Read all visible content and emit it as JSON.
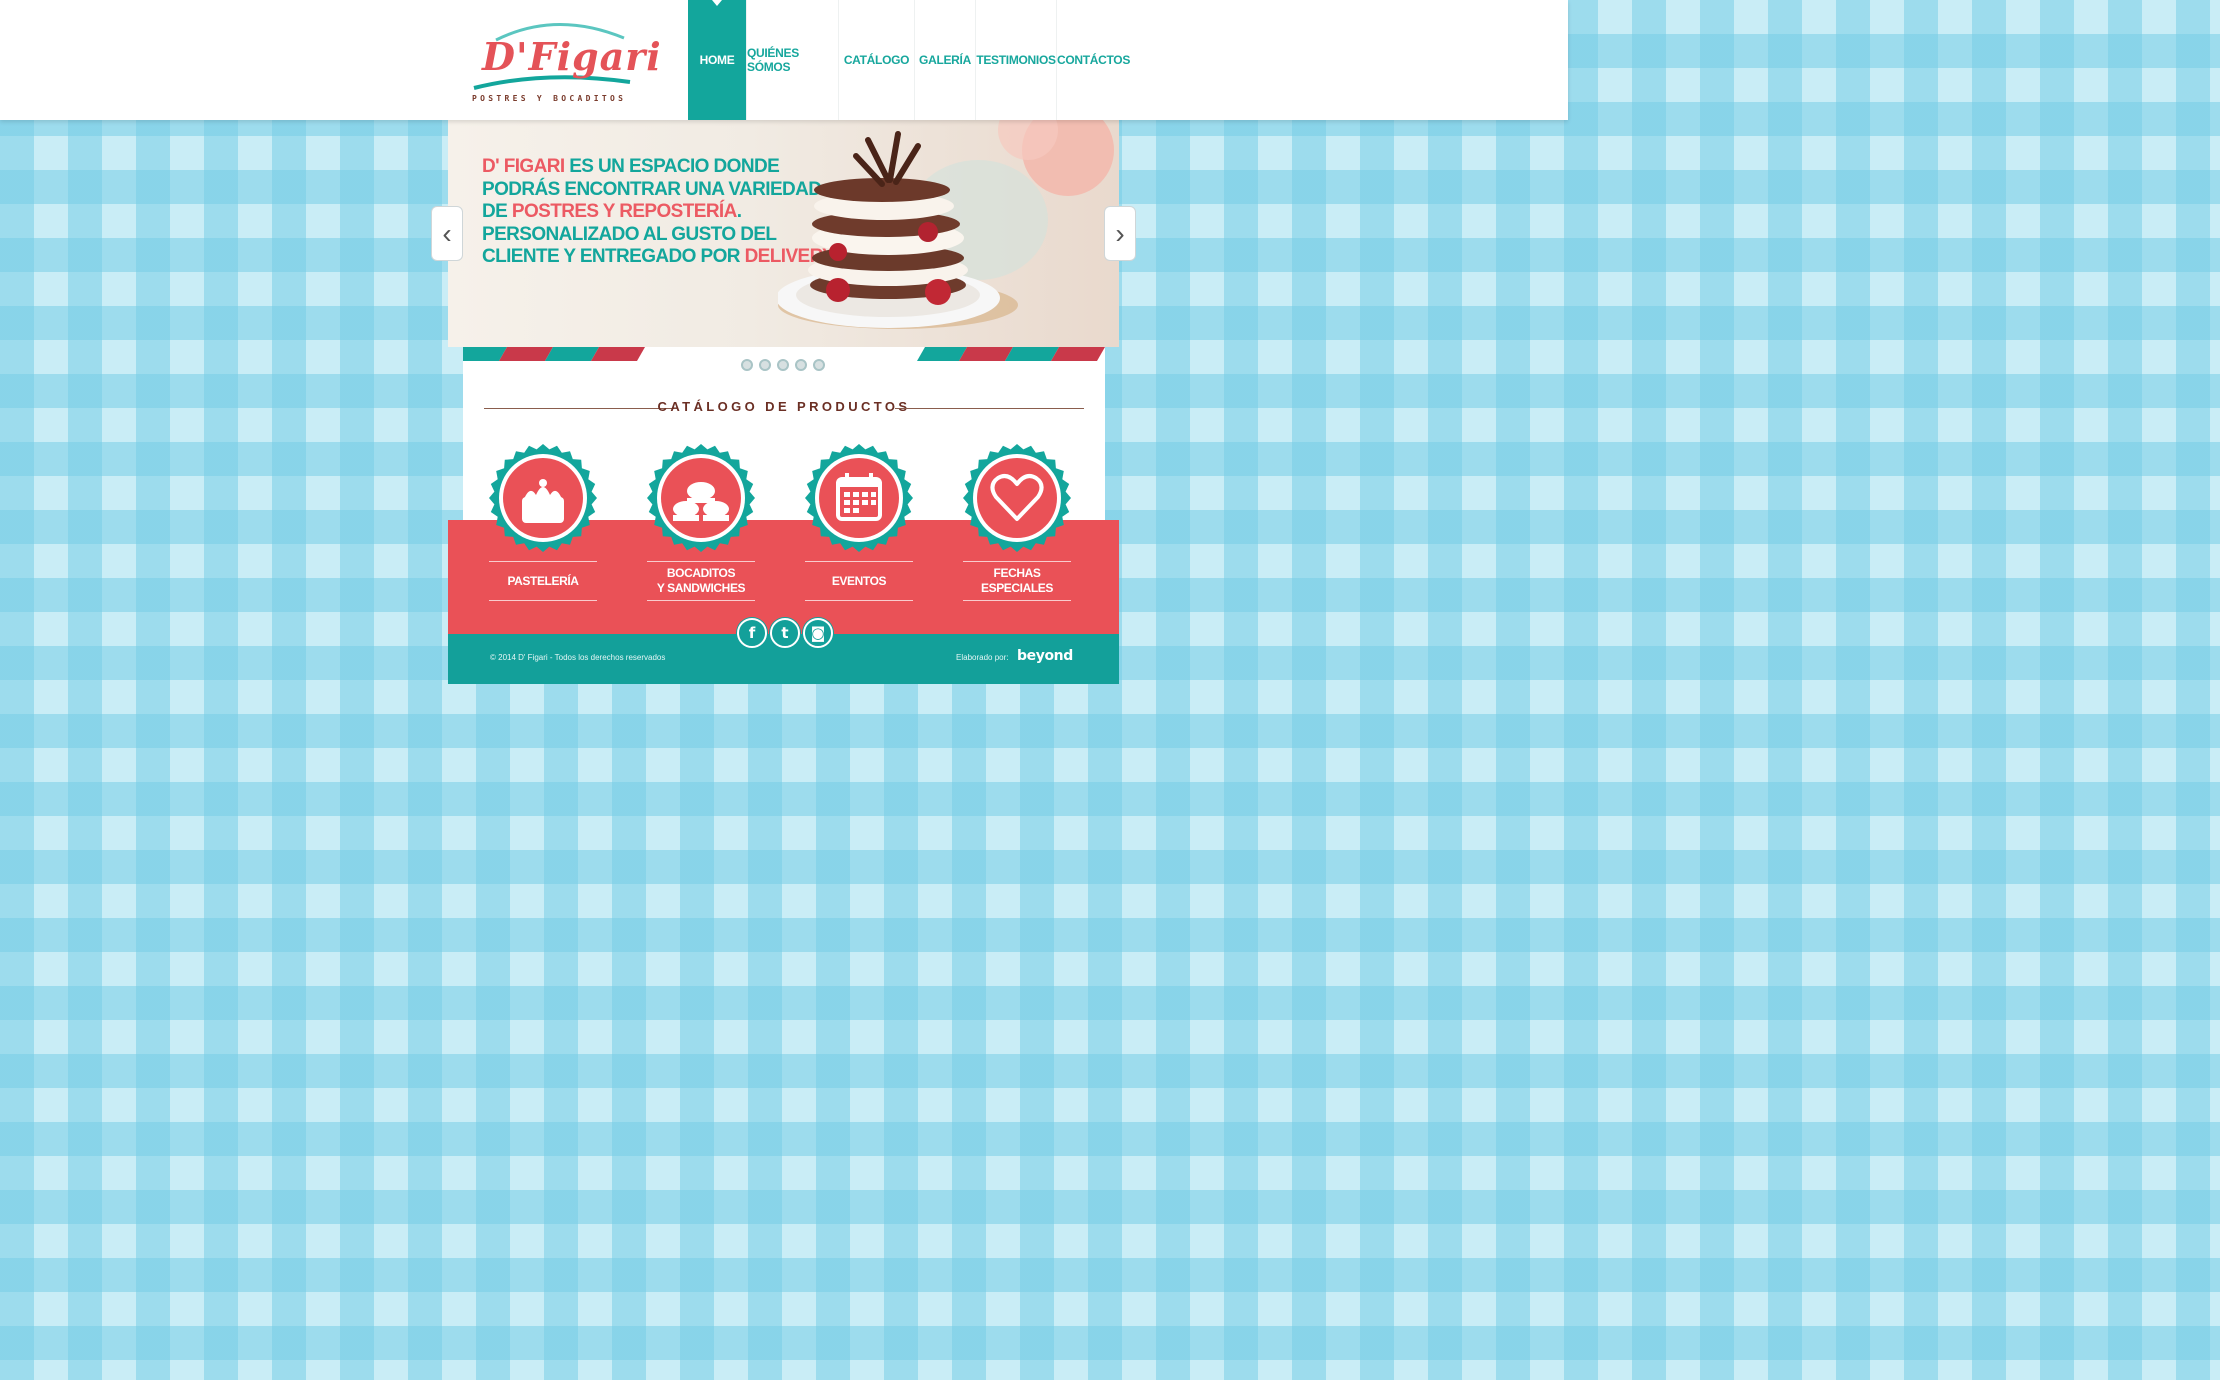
{
  "brand": {
    "name": "D'Figari",
    "tagline": "POSTRES Y BOCADITOS"
  },
  "nav": {
    "items": [
      {
        "label": "HOME"
      },
      {
        "label": "QUIÉNES SÓMOS"
      },
      {
        "label": "CATÁLOGO"
      },
      {
        "label": "GALERÍA"
      },
      {
        "label": "TESTIMONIOS"
      },
      {
        "label": "CONTÁCTOS"
      }
    ],
    "active_index": 0
  },
  "slider": {
    "text_parts": [
      {
        "text": "D' Figari",
        "highlight": true
      },
      {
        "text": " es un espacio donde podrás encontrar una variedad de ",
        "highlight": false
      },
      {
        "text": "postres y repostería",
        "highlight": true
      },
      {
        "text": ". Personalizado al gusto del cliente y entregado por ",
        "highlight": false
      },
      {
        "text": "delivery",
        "highlight": true
      },
      {
        "text": ".",
        "highlight": false
      }
    ],
    "prev_icon": "chevron-left-icon",
    "next_icon": "chevron-right-icon",
    "slide_count": 5
  },
  "catalog": {
    "title": "CATÁLOGO DE PRODUCTOS",
    "products": [
      {
        "label": "PASTELERÍA",
        "icon": "cake-icon"
      },
      {
        "label": "BOCADITOS\nY SANDWICHES",
        "icon": "sandwich-icon"
      },
      {
        "label": "EVENTOS",
        "icon": "calendar-icon"
      },
      {
        "label": "FECHAS ESPECIALES",
        "icon": "heart-icon"
      }
    ]
  },
  "social": [
    {
      "name": "facebook-icon",
      "glyph": "f"
    },
    {
      "name": "twitter-icon",
      "glyph": "t"
    },
    {
      "name": "instagram-icon",
      "glyph": "◙"
    }
  ],
  "footer": {
    "copyright": "© 2014 D' Figari - Todos los derechos reservados",
    "credit_label": "Elaborado por:",
    "credit_brand": "beyond"
  },
  "colors": {
    "teal": "#13a69c",
    "coral": "#ea5157",
    "brown": "#6b2f24",
    "pink_highlight": "#ec5a63"
  }
}
